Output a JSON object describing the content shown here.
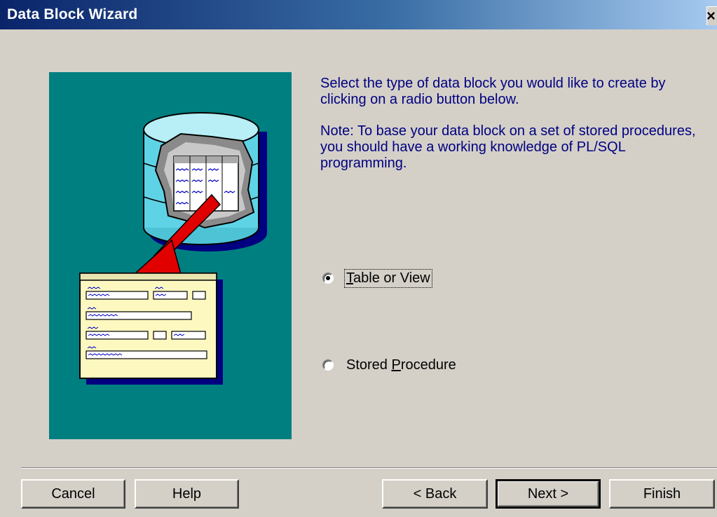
{
  "window": {
    "title": "Data Block Wizard",
    "close_glyph": "×"
  },
  "instructions": {
    "line1": "Select the type of data block you would like to create by clicking on a radio button below.",
    "line2": "Note: To base your data block on a set of stored procedures, you should have a working knowledge of PL/SQL programming."
  },
  "options": [
    {
      "mnemonic": "T",
      "rest": "able or View",
      "selected": true
    },
    {
      "prefix": "Stored ",
      "mnemonic": "P",
      "rest": "rocedure",
      "selected": false
    }
  ],
  "buttons": {
    "cancel": "Cancel",
    "help": "Help",
    "back": "< Back",
    "next": "Next >",
    "finish": "Finish"
  },
  "colors": {
    "title_gradient_start": "#0a246a",
    "panel_teal": "#007f80",
    "instruction_text": "#000080",
    "dialog_bg": "#d4d0c8"
  },
  "icons": [
    "database-cylinder-icon",
    "form-sheet-icon",
    "red-arrow-icon",
    "close-icon"
  ]
}
